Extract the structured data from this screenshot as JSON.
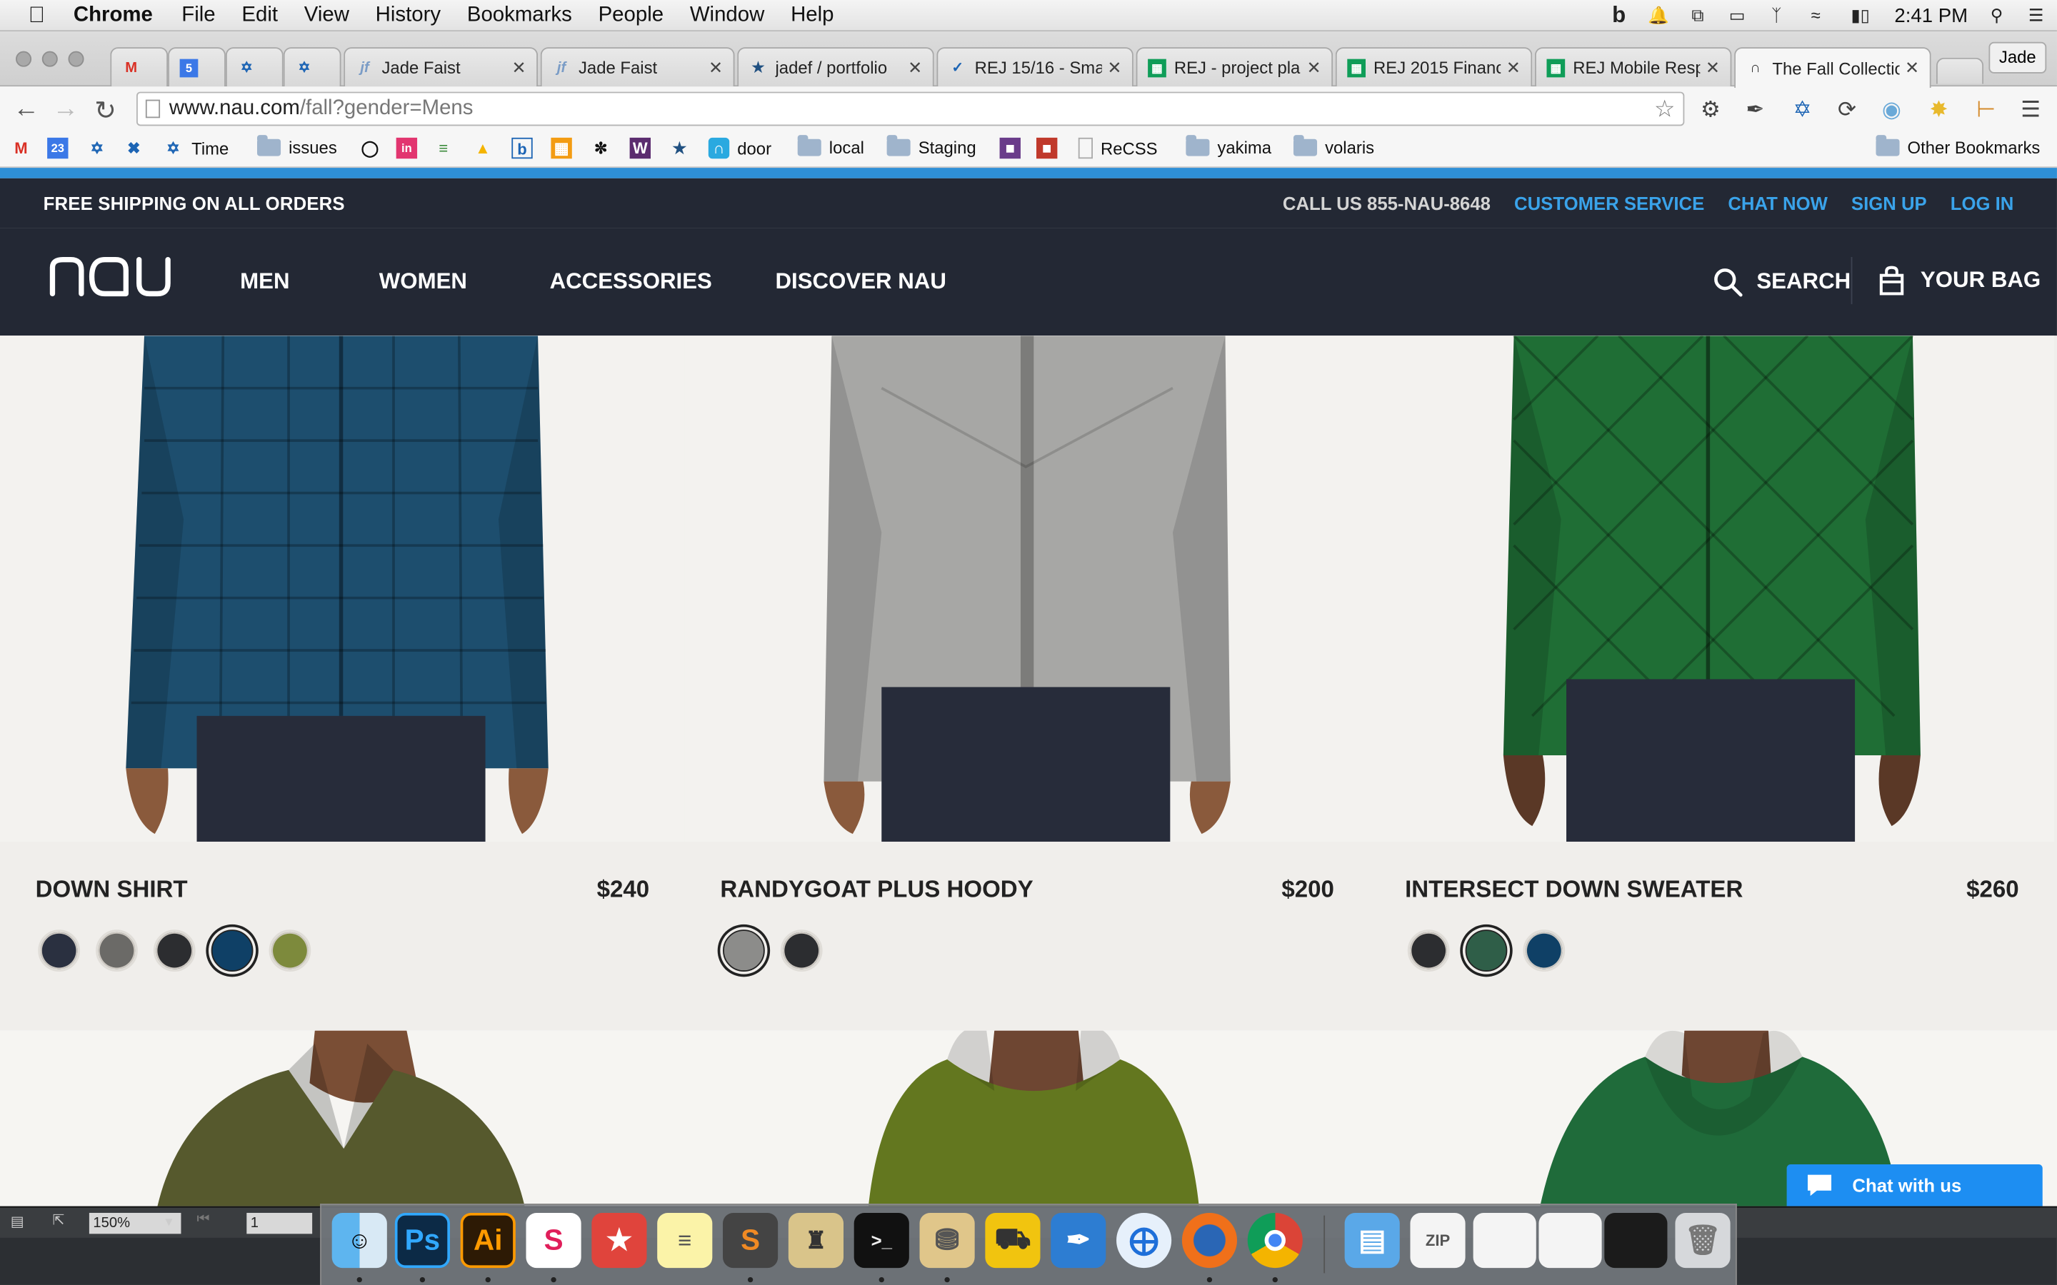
{
  "menubar": {
    "app": "Chrome",
    "items": [
      "File",
      "Edit",
      "View",
      "History",
      "Bookmarks",
      "People",
      "Window",
      "Help"
    ],
    "time": "2:41 PM"
  },
  "tabs": [
    {
      "title": "",
      "icon": "gmail-icon"
    },
    {
      "title": "",
      "icon": "calendar-icon"
    },
    {
      "title": "",
      "icon": "jira-icon"
    },
    {
      "title": "",
      "icon": "jira-icon"
    },
    {
      "title": "Jade Faist",
      "icon": "jf-icon"
    },
    {
      "title": "Jade Faist",
      "icon": "jf-icon"
    },
    {
      "title": "jadef / portfolio",
      "icon": "bitbucket-icon"
    },
    {
      "title": "REJ 15/16 - Sma",
      "icon": "check-icon"
    },
    {
      "title": "REJ - project pla",
      "icon": "sheets-icon"
    },
    {
      "title": "REJ 2015 Financ",
      "icon": "sheets-icon"
    },
    {
      "title": "REJ Mobile Resp",
      "icon": "sheets-icon"
    },
    {
      "title": "The Fall Collectio",
      "icon": "nau-icon"
    }
  ],
  "profile": "Jade",
  "url": {
    "host": "www.nau.com",
    "path": "/fall?gender=Mens"
  },
  "bookmarks": [
    {
      "label": "",
      "icon": "gmail-icon"
    },
    {
      "label": "",
      "icon": "calendar-icon"
    },
    {
      "label": "",
      "icon": "jira-icon"
    },
    {
      "label": "",
      "icon": "jira-icon"
    },
    {
      "label": "Time",
      "icon": "jira-icon"
    },
    {
      "label": "issues",
      "icon": "folder-icon"
    },
    {
      "label": "",
      "icon": "github-icon"
    },
    {
      "label": "",
      "icon": "invision-icon"
    },
    {
      "label": "",
      "icon": "bars-icon"
    },
    {
      "label": "",
      "icon": "drive-icon"
    },
    {
      "label": "",
      "icon": "b-icon"
    },
    {
      "label": "",
      "icon": "grid-icon"
    },
    {
      "label": "",
      "icon": "swirl-icon"
    },
    {
      "label": "",
      "icon": "w-icon"
    },
    {
      "label": "",
      "icon": "bitbucket-icon"
    },
    {
      "label": "door",
      "icon": "door-icon"
    },
    {
      "label": "local",
      "icon": "folder-icon"
    },
    {
      "label": "Staging",
      "icon": "folder-icon"
    },
    {
      "label": "",
      "icon": "app-icon"
    },
    {
      "label": "",
      "icon": "app-icon"
    },
    {
      "label": "ReCSS",
      "icon": "page-icon"
    },
    {
      "label": "yakima",
      "icon": "folder-icon"
    },
    {
      "label": "volaris",
      "icon": "folder-icon"
    }
  ],
  "other_bookmarks": "Other Bookmarks",
  "site": {
    "shipping": "FREE SHIPPING ON ALL ORDERS",
    "call": "CALL US 855-NAU-8648",
    "links": [
      "CUSTOMER SERVICE",
      "CHAT NOW",
      "SIGN UP",
      "LOG IN"
    ],
    "logo": "nau",
    "nav": [
      "MEN",
      "WOMEN",
      "ACCESSORIES",
      "DISCOVER NAU"
    ],
    "search": "SEARCH",
    "bag": "YOUR BAG"
  },
  "products": [
    {
      "name": "DOWN SHIRT",
      "price": "$240",
      "jacket_color": "#1d4e6e",
      "swatches": [
        "#2a3040",
        "#6b6a67",
        "#2c2d30",
        "#0f4066",
        "#7d8a3c"
      ],
      "selected": 3
    },
    {
      "name": "RANDYGOAT PLUS HOODY",
      "price": "$200",
      "jacket_color": "#a7a7a5",
      "swatches": [
        "#8c8c8a",
        "#2c2d30"
      ],
      "selected": 0
    },
    {
      "name": "INTERSECT DOWN SWEATER",
      "price": "$260",
      "jacket_color": "#1f6e35",
      "swatches": [
        "#2c2d30",
        "#2f5e48",
        "#0f4066"
      ],
      "selected": 1
    }
  ],
  "row2_colors": [
    "#56592d",
    "#63771f",
    "#1f6b3a"
  ],
  "chat": "Chat with us",
  "statusbar": {
    "zoom": "150%",
    "page": "1"
  },
  "colors": {
    "nav_bg": "#232834",
    "link_blue": "#3aa3ea",
    "accent_bar": "#2e8fd6",
    "chat_blue": "#1d8ef2"
  }
}
